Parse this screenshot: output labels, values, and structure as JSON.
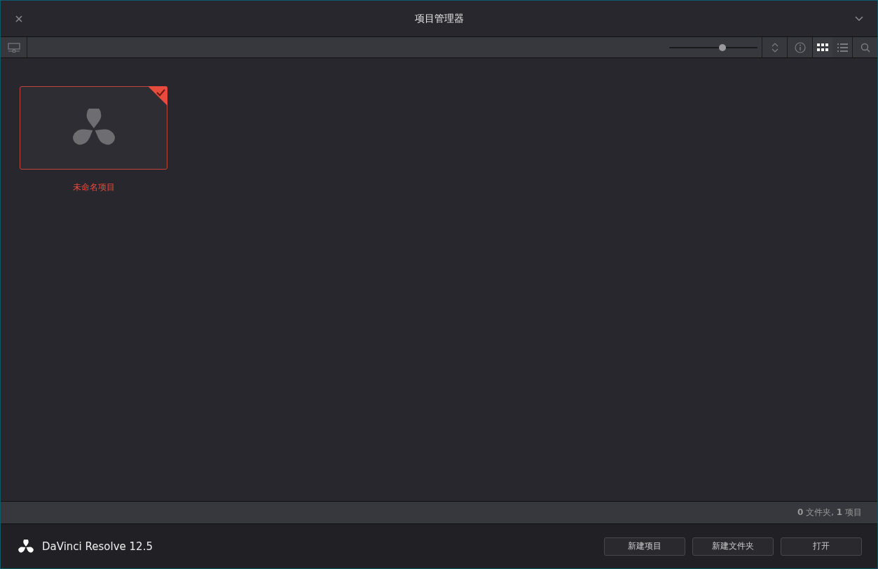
{
  "window": {
    "title": "项目管理器"
  },
  "toolbar": {
    "zoom": {
      "level": 0.6
    },
    "view_modes": [
      {
        "kind": "grid",
        "selected": true
      },
      {
        "kind": "list",
        "selected": false
      }
    ]
  },
  "projects": [
    {
      "name": "未命名项目",
      "selected": true
    }
  ],
  "status_bar": {
    "text": "**0** 文件夹, **1** 项目"
  },
  "footer": {
    "app_name": "DaVinci Resolve 12.5",
    "buttons": [
      "新建项目",
      "新建文件夹",
      "打开"
    ]
  }
}
